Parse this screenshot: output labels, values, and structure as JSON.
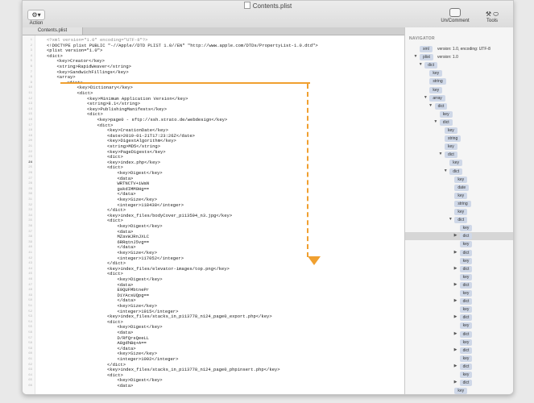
{
  "window": {
    "title": "Contents.plist",
    "toolbar": {
      "action_icon": "⚙▾",
      "action_label": "Action",
      "comment_label": "Un/Comment",
      "tools_icon": "⚒ ⬭",
      "tools_label": "Tools"
    },
    "tabs": [
      {
        "label": "Contents.plist"
      }
    ]
  },
  "editor": {
    "current_line": 24,
    "lines": [
      {
        "n": "1",
        "indent": 0,
        "cls": "pi",
        "text": "<?xml version=\"1.0\" encoding=\"UTF-8\"?>"
      },
      {
        "n": "2",
        "indent": 0,
        "cls": "doctype",
        "text": "<!DOCTYPE plist PUBLIC \"-//Apple//DTD PLIST 1.0//EN\" \"http://www.apple.com/DTDs/PropertyList-1.0.dtd\">"
      },
      {
        "n": "3",
        "indent": 0,
        "text": "<plist version=\"1.0\">"
      },
      {
        "n": "4",
        "indent": 0,
        "text": "<dict>"
      },
      {
        "n": "5",
        "indent": 1,
        "text": "<key>Creator</key>"
      },
      {
        "n": "6",
        "indent": 1,
        "text": "<string>RapidWeaver</string>"
      },
      {
        "n": "7",
        "indent": 1,
        "text": "<key>SandwichFillings</key>"
      },
      {
        "n": "8",
        "indent": 1,
        "text": "<array>"
      },
      {
        "n": "9",
        "indent": 2,
        "text": "<dict>"
      },
      {
        "n": "10",
        "indent": 3,
        "text": "<key>Dictionary</key>"
      },
      {
        "n": "11",
        "indent": 3,
        "text": "<dict>"
      },
      {
        "n": "12",
        "indent": 4,
        "text": "<key>Minimum Application Version</key>"
      },
      {
        "n": "13",
        "indent": 4,
        "text": "<string>8.1</string>"
      },
      {
        "n": "14",
        "indent": 4,
        "text": "<key>PublishingManifests</key>"
      },
      {
        "n": "15",
        "indent": 4,
        "text": "<dict>"
      },
      {
        "n": "16",
        "indent": 5,
        "text": "<key>page0 - sftp://ssh.strato.de/webdesign</key>"
      },
      {
        "n": "17",
        "indent": 5,
        "text": "<dict>"
      },
      {
        "n": "18",
        "indent": 6,
        "text": "<key>CreationDate</key>"
      },
      {
        "n": "19",
        "indent": 6,
        "text": "<date>2019-01-21T17:23:26Z</date>"
      },
      {
        "n": "20",
        "indent": 6,
        "text": "<key>DigestAlgorithm</key>"
      },
      {
        "n": "21",
        "indent": 6,
        "text": "<string>MD5</string>"
      },
      {
        "n": "22",
        "indent": 6,
        "text": "<key>PageDigests</key>"
      },
      {
        "n": "23",
        "indent": 6,
        "text": "<dict>"
      },
      {
        "n": "24",
        "indent": 6,
        "text": "<key>index.php</key>"
      },
      {
        "n": "25",
        "indent": 6,
        "text": "<dict>"
      },
      {
        "n": "26",
        "indent": 7,
        "text": "<key>Digest</key>"
      },
      {
        "n": "27",
        "indent": 7,
        "text": "<data>"
      },
      {
        "n": "28",
        "indent": 7,
        "text": "WRTNCTV+iWaN"
      },
      {
        "n": "29",
        "indent": 7,
        "text": "gakdIMM0Hg=="
      },
      {
        "n": "30",
        "indent": 7,
        "text": "</data>"
      },
      {
        "n": "31",
        "indent": 7,
        "text": "<key>Size</key>"
      },
      {
        "n": "32",
        "indent": 7,
        "text": "<integer>118438</integer>"
      },
      {
        "n": "33",
        "indent": 6,
        "text": "</dict>"
      },
      {
        "n": "34",
        "indent": 6,
        "text": "<key>index_files/bodyCover_p113594_n3.jpg</key>"
      },
      {
        "n": "35",
        "indent": 6,
        "text": "<dict>"
      },
      {
        "n": "36",
        "indent": 7,
        "text": "<key>Digest</key>"
      },
      {
        "n": "37",
        "indent": 7,
        "text": "<data>"
      },
      {
        "n": "38",
        "indent": 7,
        "text": "MZavWJRnJXLC"
      },
      {
        "n": "39",
        "indent": 7,
        "text": "6RRqtnJ5vg=="
      },
      {
        "n": "40",
        "indent": 7,
        "text": "</data>"
      },
      {
        "n": "41",
        "indent": 7,
        "text": "<key>Size</key>"
      },
      {
        "n": "42",
        "indent": 7,
        "text": "<integer>117052</integer>"
      },
      {
        "n": "43",
        "indent": 6,
        "text": "</dict>"
      },
      {
        "n": "44",
        "indent": 6,
        "text": "<key>index_files/elevator-images/top.png</key>"
      },
      {
        "n": "45",
        "indent": 6,
        "text": "<dict>"
      },
      {
        "n": "46",
        "indent": 7,
        "text": "<key>Digest</key>"
      },
      {
        "n": "47",
        "indent": 7,
        "text": "<data>"
      },
      {
        "n": "48",
        "indent": 7,
        "text": "E9QUFMbtnePr"
      },
      {
        "n": "49",
        "indent": 7,
        "text": "DiYAcsUQpg=="
      },
      {
        "n": "50",
        "indent": 7,
        "text": "</data>"
      },
      {
        "n": "51",
        "indent": 7,
        "text": "<key>Size</key>"
      },
      {
        "n": "52",
        "indent": 7,
        "text": "<integer>1915</integer>"
      },
      {
        "n": "53",
        "indent": 6,
        "text": "<key>index_files/stacks_in_p113778_n124_page0_export.php</key>"
      },
      {
        "n": "54",
        "indent": 6,
        "text": "<dict>"
      },
      {
        "n": "55",
        "indent": 7,
        "text": "<key>Digest</key>"
      },
      {
        "n": "56",
        "indent": 7,
        "text": "<data>"
      },
      {
        "n": "57",
        "indent": 7,
        "text": "D/RfQrsQeeLL"
      },
      {
        "n": "58",
        "indent": 7,
        "text": "A8gdhBq+A=="
      },
      {
        "n": "59",
        "indent": 7,
        "text": "</data>"
      },
      {
        "n": "60",
        "indent": 7,
        "text": "<key>Size</key>"
      },
      {
        "n": "61",
        "indent": 7,
        "text": "<integer>1092</integer>"
      },
      {
        "n": "62",
        "indent": 6,
        "text": "</dict>"
      },
      {
        "n": "63",
        "indent": 6,
        "text": "<key>index_files/stacks_in_p113778_n124_page0_phpinsert.php</key>"
      },
      {
        "n": "64",
        "indent": 6,
        "text": "<dict>"
      },
      {
        "n": "65",
        "indent": 7,
        "text": "<key>Digest</key>"
      },
      {
        "n": "66",
        "indent": 7,
        "text": "<data>"
      }
    ]
  },
  "annotation": {
    "color": "#f0a030"
  },
  "navigator": {
    "title": "NAVIGATOR",
    "rows": [
      {
        "level": 0,
        "label": "xml",
        "disclosure": "",
        "note": "version: 1.0, encoding: UTF-8",
        "icon": "xml-doc-icon"
      },
      {
        "level": 0,
        "label": "plist",
        "disclosure": "▼",
        "note": "version: 1.0"
      },
      {
        "level": 1,
        "label": "dict",
        "disclosure": "▼"
      },
      {
        "level": 2,
        "label": "key",
        "disclosure": ""
      },
      {
        "level": 2,
        "label": "string",
        "disclosure": ""
      },
      {
        "level": 2,
        "label": "key",
        "disclosure": ""
      },
      {
        "level": 2,
        "label": "array",
        "disclosure": "▼"
      },
      {
        "level": 3,
        "label": "dict",
        "disclosure": "▼"
      },
      {
        "level": 4,
        "label": "key",
        "disclosure": ""
      },
      {
        "level": 4,
        "label": "dict",
        "disclosure": "▼"
      },
      {
        "level": 5,
        "label": "key",
        "disclosure": ""
      },
      {
        "level": 5,
        "label": "string",
        "disclosure": ""
      },
      {
        "level": 5,
        "label": "key",
        "disclosure": ""
      },
      {
        "level": 5,
        "label": "dict",
        "disclosure": "▼"
      },
      {
        "level": 6,
        "label": "key",
        "disclosure": ""
      },
      {
        "level": 6,
        "label": "dict",
        "disclosure": "▼"
      },
      {
        "level": 7,
        "label": "key",
        "disclosure": ""
      },
      {
        "level": 7,
        "label": "date",
        "disclosure": ""
      },
      {
        "level": 7,
        "label": "key",
        "disclosure": ""
      },
      {
        "level": 7,
        "label": "string",
        "disclosure": ""
      },
      {
        "level": 7,
        "label": "key",
        "disclosure": ""
      },
      {
        "level": 7,
        "label": "dict",
        "disclosure": "▼"
      },
      {
        "level": 8,
        "label": "key",
        "disclosure": ""
      },
      {
        "level": 8,
        "label": "dict",
        "disclosure": "▶",
        "selected": true
      },
      {
        "level": 8,
        "label": "key",
        "disclosure": ""
      },
      {
        "level": 8,
        "label": "dict",
        "disclosure": "▶"
      },
      {
        "level": 8,
        "label": "key",
        "disclosure": ""
      },
      {
        "level": 8,
        "label": "dict",
        "disclosure": "▶"
      },
      {
        "level": 8,
        "label": "key",
        "disclosure": ""
      },
      {
        "level": 8,
        "label": "dict",
        "disclosure": "▶"
      },
      {
        "level": 8,
        "label": "key",
        "disclosure": ""
      },
      {
        "level": 8,
        "label": "dict",
        "disclosure": "▶"
      },
      {
        "level": 8,
        "label": "key",
        "disclosure": ""
      },
      {
        "level": 8,
        "label": "dict",
        "disclosure": "▶"
      },
      {
        "level": 8,
        "label": "key",
        "disclosure": ""
      },
      {
        "level": 8,
        "label": "dict",
        "disclosure": "▶"
      },
      {
        "level": 8,
        "label": "key",
        "disclosure": ""
      },
      {
        "level": 8,
        "label": "dict",
        "disclosure": "▶"
      },
      {
        "level": 8,
        "label": "key",
        "disclosure": ""
      },
      {
        "level": 8,
        "label": "dict",
        "disclosure": "▶"
      },
      {
        "level": 8,
        "label": "key",
        "disclosure": ""
      },
      {
        "level": 8,
        "label": "dict",
        "disclosure": "▶"
      },
      {
        "level": 7,
        "label": "key",
        "disclosure": ""
      },
      {
        "level": 7,
        "label": "string",
        "disclosure": ""
      },
      {
        "level": 7,
        "label": "key",
        "disclosure": ""
      }
    ]
  }
}
